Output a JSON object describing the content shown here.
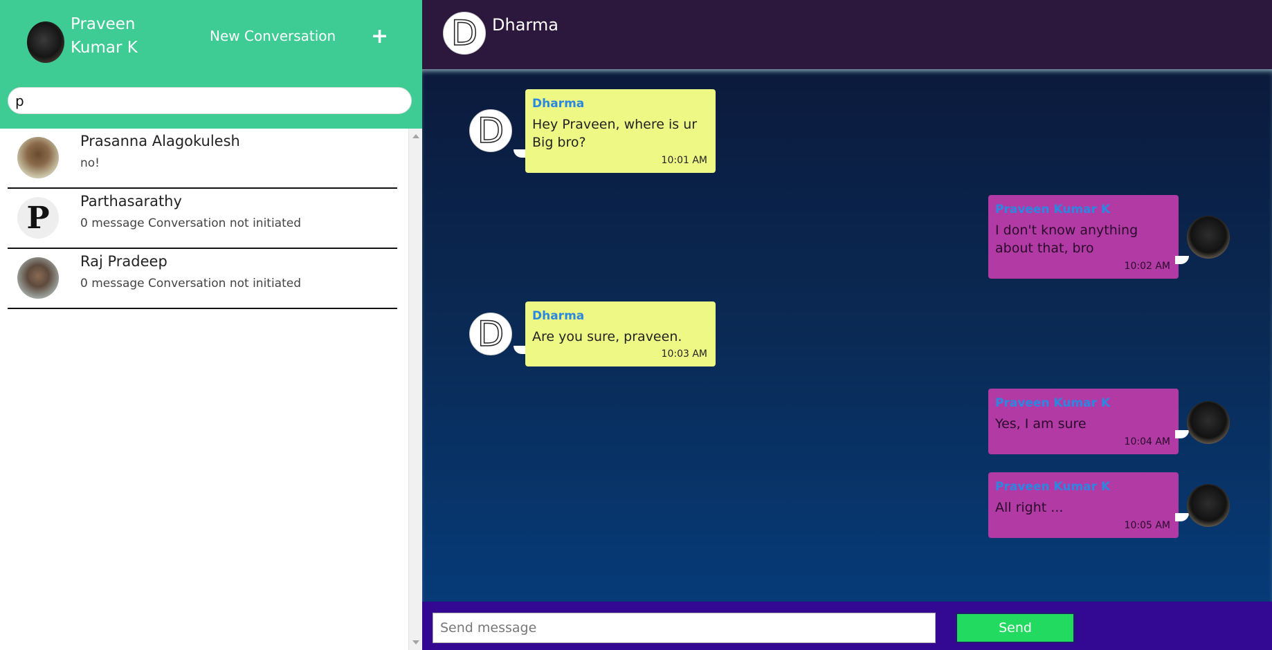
{
  "sidebar": {
    "user_name": "Praveen Kumar K",
    "new_conversation_label": "New Conversation",
    "plus_icon": "+",
    "search_value": "p",
    "contacts": [
      {
        "name": "Prasanna Alagokulesh",
        "preview": "no!"
      },
      {
        "name": "Parthasarathy",
        "preview": "0 message Conversation not initiated",
        "avatar_letter": "P"
      },
      {
        "name": "Raj Pradeep",
        "preview": "0 message Conversation not initiated"
      }
    ]
  },
  "chat": {
    "contact_name": "Dharma",
    "avatar_letter": "D",
    "messages": [
      {
        "sender": "Dharma",
        "text": "Hey Praveen, where is ur Big bro?",
        "time": "10:01 AM",
        "direction": "incoming"
      },
      {
        "sender": "Praveen Kumar K",
        "text": "I don't know anything about that, bro",
        "time": "10:02 AM",
        "direction": "outgoing"
      },
      {
        "sender": "Dharma",
        "text": "Are you sure, praveen.",
        "time": "10:03 AM",
        "direction": "incoming"
      },
      {
        "sender": "Praveen Kumar K",
        "text": "Yes, I am sure",
        "time": "10:04 AM",
        "direction": "outgoing"
      },
      {
        "sender": "Praveen Kumar K",
        "text": "All right ...",
        "time": "10:05 AM",
        "direction": "outgoing"
      }
    ]
  },
  "composer": {
    "placeholder": "Send message",
    "send_label": "Send"
  },
  "colors": {
    "sidebar_header": "#3ecb94",
    "chat_header": "#2c183c",
    "incoming_bubble": "#eef985",
    "outgoing_bubble": "#b23aa5",
    "composer_bar": "#330893",
    "send_button": "#22da60"
  }
}
